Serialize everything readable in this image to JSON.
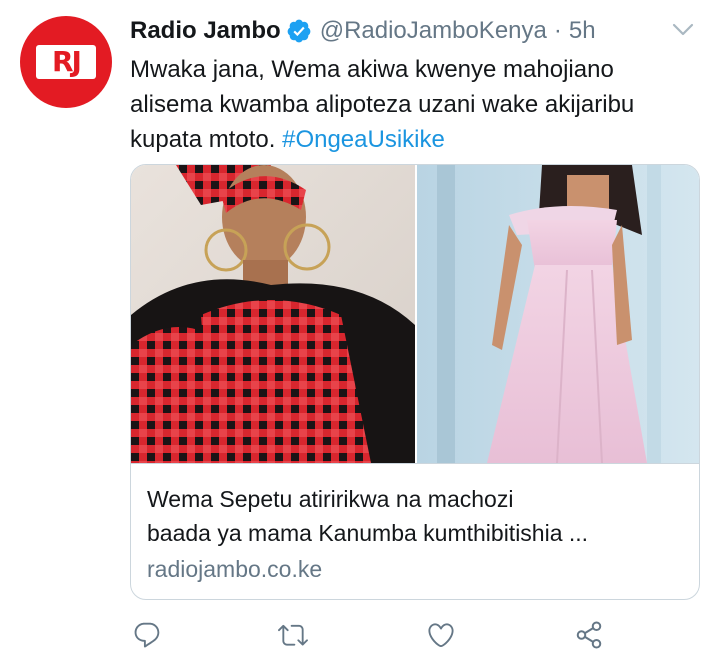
{
  "tweet": {
    "display_name": "Radio Jambo",
    "handle": "@RadioJamboKenya",
    "separator": "·",
    "time": "5h",
    "avatar_text": "RJ",
    "text_main": "Mwaka jana, Wema akiwa kwenye mahojiano alisema kwamba alipoteza uzani wake akijaribu kupata mtoto. ",
    "hashtag": "#OngeaUsikike"
  },
  "card": {
    "title_line1": "Wema Sepetu atiririkwa na machozi",
    "title_line2": "baada ya mama Kanumba kumthibitishia ...",
    "domain": "radiojambo.co.ke"
  },
  "icons": {
    "verified": "verified-badge-icon",
    "caret": "chevron-down-icon",
    "reply": "reply-icon",
    "retweet": "retweet-icon",
    "like": "heart-icon",
    "share": "share-icon"
  },
  "colors": {
    "brand_red": "#e31b23",
    "link_blue": "#1b95e0",
    "secondary_text": "#657786",
    "border": "#ccd6dd"
  }
}
